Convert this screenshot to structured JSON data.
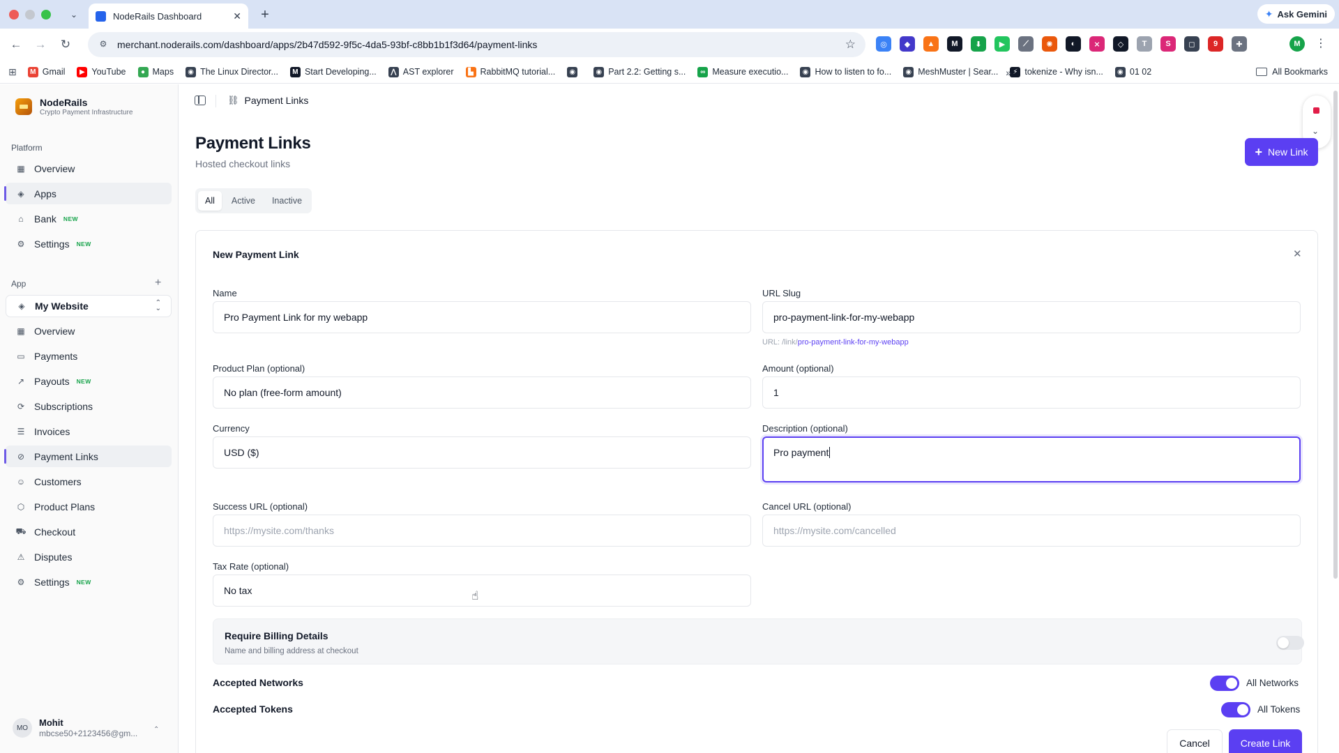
{
  "browser": {
    "tab_title": "NodeRails Dashboard",
    "ask_gemini": "Ask Gemini",
    "url": "merchant.noderails.com/dashboard/apps/2b47d592-9f5c-4da5-93bf-c8bb1b1f3d64/payment-links",
    "profile_initial": "M",
    "bookmarks": [
      {
        "label": "Gmail",
        "color": "#ea4335",
        "glyph": "M"
      },
      {
        "label": "YouTube",
        "color": "#ff0000",
        "glyph": "▶"
      },
      {
        "label": "Maps",
        "color": "#34a853",
        "glyph": "●"
      },
      {
        "label": "The Linux Director...",
        "color": "#374151",
        "glyph": "◉"
      },
      {
        "label": "Start Developing...",
        "color": "#111827",
        "glyph": "M"
      },
      {
        "label": "AST explorer",
        "color": "#374151",
        "glyph": "⋀"
      },
      {
        "label": "RabbitMQ tutorial...",
        "color": "#f97316",
        "glyph": "▙"
      },
      {
        "label": "",
        "color": "#374151",
        "glyph": "◉"
      },
      {
        "label": "Part 2.2: Getting s...",
        "color": "#374151",
        "glyph": "◉"
      },
      {
        "label": "Measure executio...",
        "color": "#16a34a",
        "glyph": "∞"
      },
      {
        "label": "How to listen to fo...",
        "color": "#374151",
        "glyph": "◉"
      },
      {
        "label": "MeshMuster | Sear...",
        "color": "#374151",
        "glyph": "◉"
      },
      {
        "label": "tokenize - Why isn...",
        "color": "#111827",
        "glyph": "⚡"
      },
      {
        "label": "01 02",
        "color": "#374151",
        "glyph": "◉"
      }
    ],
    "all_bookmarks": "All Bookmarks",
    "more_glyph": "»"
  },
  "sidebar": {
    "brand_name": "NodeRails",
    "brand_sub": "Crypto Payment Infrastructure",
    "platform_label": "Platform",
    "platform_items": [
      {
        "label": "Overview",
        "icon": "▦",
        "badge": ""
      },
      {
        "label": "Apps",
        "icon": "◈",
        "badge": ""
      },
      {
        "label": "Bank",
        "icon": "⌂",
        "badge": "NEW"
      },
      {
        "label": "Settings",
        "icon": "⚙",
        "badge": "NEW"
      }
    ],
    "app_label": "App",
    "app_add": "+",
    "app_selected": "My Website",
    "app_items": [
      {
        "label": "Overview",
        "icon": "▦",
        "badge": ""
      },
      {
        "label": "Payments",
        "icon": "▭",
        "badge": ""
      },
      {
        "label": "Payouts",
        "icon": "↗",
        "badge": "NEW"
      },
      {
        "label": "Subscriptions",
        "icon": "⟳",
        "badge": ""
      },
      {
        "label": "Invoices",
        "icon": "☰",
        "badge": ""
      },
      {
        "label": "Payment Links",
        "icon": "⊘",
        "badge": ""
      },
      {
        "label": "Customers",
        "icon": "☺",
        "badge": ""
      },
      {
        "label": "Product Plans",
        "icon": "⬡",
        "badge": ""
      },
      {
        "label": "Checkout",
        "icon": "⛟",
        "badge": ""
      },
      {
        "label": "Disputes",
        "icon": "⚠",
        "badge": ""
      },
      {
        "label": "Settings",
        "icon": "⚙",
        "badge": "NEW"
      }
    ],
    "user_initials": "MO",
    "user_name": "Mohit",
    "user_email": "mbcse50+2123456@gm..."
  },
  "header": {
    "breadcrumb": "Payment Links",
    "page_title": "Payment Links",
    "page_subtitle": "Hosted checkout links",
    "new_link_label": "New Link"
  },
  "filters": [
    "All",
    "Active",
    "Inactive"
  ],
  "form": {
    "title": "New Payment Link",
    "name_label": "Name",
    "name_value": "Pro Payment Link for my webapp",
    "slug_label": "URL Slug",
    "slug_value": "pro-payment-link-for-my-webapp",
    "slug_hint_prefix": "URL: /link/",
    "slug_hint_value": "pro-payment-link-for-my-webapp",
    "plan_label": "Product Plan (optional)",
    "plan_value": "No plan (free-form amount)",
    "amount_label": "Amount (optional)",
    "amount_value": "1",
    "currency_label": "Currency",
    "currency_value": "USD ($)",
    "description_label": "Description (optional)",
    "description_value": "Pro payment",
    "success_label": "Success URL (optional)",
    "success_placeholder": "https://mysite.com/thanks",
    "cancel_url_label": "Cancel URL (optional)",
    "cancel_url_placeholder": "https://mysite.com/cancelled",
    "tax_label": "Tax Rate (optional)",
    "tax_value": "No tax",
    "billing_title": "Require Billing Details",
    "billing_sub": "Name and billing address at checkout",
    "billing_enabled": false,
    "networks_label": "Accepted Networks",
    "networks_toggle_text": "All Networks",
    "networks_enabled": true,
    "tokens_label": "Accepted Tokens",
    "tokens_toggle_text": "All Tokens",
    "tokens_enabled": true,
    "cancel_label": "Cancel",
    "create_label": "Create Link"
  }
}
